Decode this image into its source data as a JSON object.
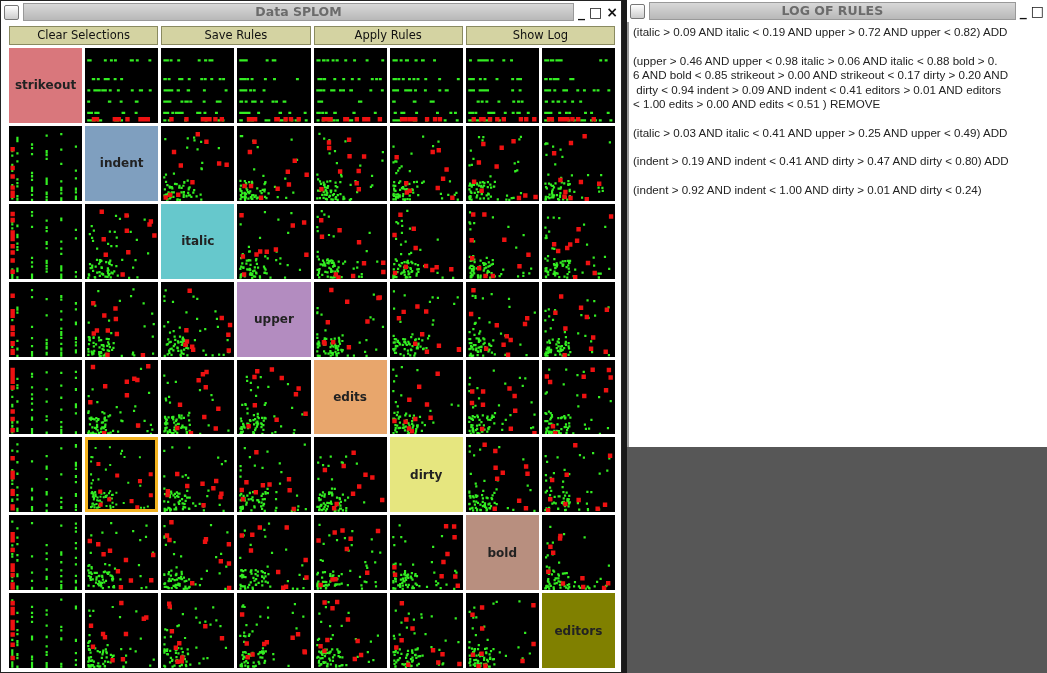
{
  "splom_window": {
    "title": "Data SPLOM",
    "controls": [
      "_",
      "□",
      "×"
    ],
    "buttons": [
      "Clear Selections",
      "Save Rules",
      "Apply Rules",
      "Show Log"
    ],
    "rows": [
      {
        "cells": [
          {
            "kind": "label",
            "label": "strikeout",
            "color": "#d9777c"
          },
          {
            "kind": "scatter",
            "selected": false
          },
          {
            "kind": "scatter",
            "selected": false
          },
          {
            "kind": "scatter",
            "selected": false
          },
          {
            "kind": "scatter",
            "selected": false
          },
          {
            "kind": "scatter",
            "selected": false
          },
          {
            "kind": "scatter",
            "selected": false
          },
          {
            "kind": "scatter",
            "selected": false
          }
        ]
      },
      {
        "cells": [
          {
            "kind": "scatter",
            "selected": false
          },
          {
            "kind": "label",
            "label": "indent",
            "color": "#7f9fbf"
          },
          {
            "kind": "scatter",
            "selected": false
          },
          {
            "kind": "scatter",
            "selected": false
          },
          {
            "kind": "scatter",
            "selected": false
          },
          {
            "kind": "scatter",
            "selected": false
          },
          {
            "kind": "scatter",
            "selected": false
          },
          {
            "kind": "scatter",
            "selected": false
          }
        ]
      },
      {
        "cells": [
          {
            "kind": "scatter",
            "selected": false
          },
          {
            "kind": "scatter",
            "selected": false
          },
          {
            "kind": "label",
            "label": "italic",
            "color": "#66c8cc"
          },
          {
            "kind": "scatter",
            "selected": false
          },
          {
            "kind": "scatter",
            "selected": false
          },
          {
            "kind": "scatter",
            "selected": false
          },
          {
            "kind": "scatter",
            "selected": false
          },
          {
            "kind": "scatter",
            "selected": false
          }
        ]
      },
      {
        "cells": [
          {
            "kind": "scatter",
            "selected": false
          },
          {
            "kind": "scatter",
            "selected": false
          },
          {
            "kind": "scatter",
            "selected": false
          },
          {
            "kind": "label",
            "label": "upper",
            "color": "#b38cc0"
          },
          {
            "kind": "scatter",
            "selected": false
          },
          {
            "kind": "scatter",
            "selected": false
          },
          {
            "kind": "scatter",
            "selected": false
          },
          {
            "kind": "scatter",
            "selected": false
          }
        ]
      },
      {
        "cells": [
          {
            "kind": "scatter",
            "selected": false
          },
          {
            "kind": "scatter",
            "selected": false
          },
          {
            "kind": "scatter",
            "selected": false
          },
          {
            "kind": "scatter",
            "selected": false
          },
          {
            "kind": "label",
            "label": "edits",
            "color": "#e8a66c"
          },
          {
            "kind": "scatter",
            "selected": false
          },
          {
            "kind": "scatter",
            "selected": false
          },
          {
            "kind": "scatter",
            "selected": false
          }
        ]
      },
      {
        "cells": [
          {
            "kind": "scatter",
            "selected": false
          },
          {
            "kind": "scatter",
            "selected": true
          },
          {
            "kind": "scatter",
            "selected": false
          },
          {
            "kind": "scatter",
            "selected": false
          },
          {
            "kind": "scatter",
            "selected": false
          },
          {
            "kind": "label",
            "label": "dirty",
            "color": "#e6e67f"
          },
          {
            "kind": "scatter",
            "selected": false
          },
          {
            "kind": "scatter",
            "selected": false
          }
        ]
      },
      {
        "cells": [
          {
            "kind": "scatter",
            "selected": false
          },
          {
            "kind": "scatter",
            "selected": false
          },
          {
            "kind": "scatter",
            "selected": false
          },
          {
            "kind": "scatter",
            "selected": false
          },
          {
            "kind": "scatter",
            "selected": false
          },
          {
            "kind": "scatter",
            "selected": false
          },
          {
            "kind": "label",
            "label": "bold",
            "color": "#b88f7f"
          },
          {
            "kind": "scatter",
            "selected": false
          }
        ]
      },
      {
        "cells": [
          {
            "kind": "scatter",
            "selected": false
          },
          {
            "kind": "scatter",
            "selected": false
          },
          {
            "kind": "scatter",
            "selected": false
          },
          {
            "kind": "scatter",
            "selected": false
          },
          {
            "kind": "scatter",
            "selected": false
          },
          {
            "kind": "scatter",
            "selected": false
          },
          {
            "kind": "scatter",
            "selected": false
          },
          {
            "kind": "label",
            "label": "editors",
            "color": "#808000"
          }
        ]
      }
    ]
  },
  "log_window": {
    "title": "LOG OF RULES",
    "controls": [
      "_",
      "□"
    ],
    "entries": [
      {
        "lines": [
          "(italic > 0.09 AND italic < 0.19 AND upper > 0.72 AND upper < 0.82) ADD"
        ]
      },
      {
        "lines": [
          "(upper > 0.46 AND upper < 0.98 italic > 0.06 AND italic < 0.88 bold > 0.",
          "6 AND bold < 0.85 strikeout > 0.00 AND strikeout < 0.17 dirty > 0.20 AND",
          " dirty < 0.94 indent > 0.09 AND indent < 0.41 editors > 0.01 AND editors",
          "< 1.00 edits > 0.00 AND edits < 0.51 ) REMOVE"
        ]
      },
      {
        "lines": [
          "(italic > 0.03 AND italic < 0.41 AND upper > 0.25 AND upper < 0.49) ADD"
        ]
      },
      {
        "lines": [
          "(indent > 0.19 AND indent < 0.41 AND dirty > 0.47 AND dirty < 0.80) ADD"
        ]
      },
      {
        "lines": [
          "(indent > 0.92 AND indent < 1.00 AND dirty > 0.01 AND dirty < 0.24)"
        ]
      }
    ]
  }
}
